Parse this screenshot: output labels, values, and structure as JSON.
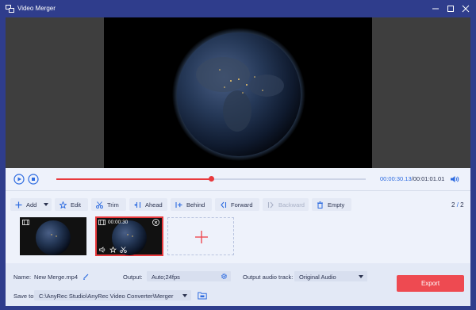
{
  "window": {
    "title": "Video Merger"
  },
  "player": {
    "current_time": "00:00:30.13",
    "total_time": "/00:01:01.01",
    "progress": 0.5
  },
  "toolbar": {
    "add": "Add",
    "edit": "Edit",
    "trim": "Trim",
    "ahead": "Ahead",
    "behind": "Behind",
    "forward": "Forward",
    "backward": "Backward",
    "empty": "Empty",
    "page_current": "2",
    "page_total": "2"
  },
  "clips": [
    {
      "time": ""
    },
    {
      "time": "00:00:30",
      "selected": true
    }
  ],
  "settings": {
    "name_label": "Name:",
    "name_value": "New Merge.mp4",
    "output_label": "Output:",
    "output_value": "Auto;24fps",
    "audio_label": "Output audio track:",
    "audio_value": "Original Audio",
    "save_label": "Save to:",
    "save_path": "C:\\AnyRec Studio\\AnyRec Video Converter\\Merger",
    "export_label": "Export"
  },
  "colors": {
    "accent": "#ee4a51",
    "titlebar": "#2f3d8c",
    "time_blue": "#2d6be0"
  }
}
